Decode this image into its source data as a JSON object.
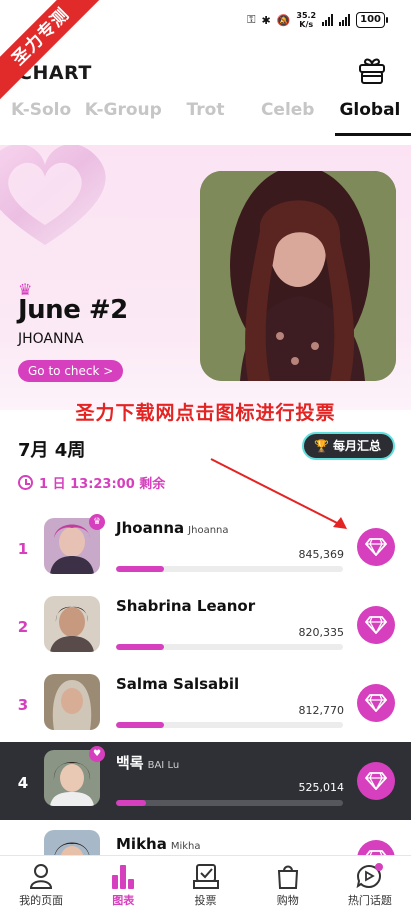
{
  "status_bar": {
    "speed_value": "35.2",
    "speed_unit": "K/s",
    "battery": "100"
  },
  "watermark": "圣力专测",
  "header": {
    "title": "CHART"
  },
  "tabs": [
    {
      "label": "K-Solo"
    },
    {
      "label": "K-Group"
    },
    {
      "label": "Trot"
    },
    {
      "label": "Celeb"
    },
    {
      "label": "Global"
    }
  ],
  "banner": {
    "headline": "June #2",
    "name": "JHOANNA",
    "cta": "Go to check >"
  },
  "overlay_text": "圣力下载网点击图标进行投票",
  "week": {
    "title": "7月 4周",
    "monthly_button": "每月汇总",
    "countdown": "1 日 13:23:00 剩余"
  },
  "ranking": [
    {
      "rank": "1",
      "name": "Jhoanna",
      "sub": "Jhoanna",
      "votes": "845,369",
      "progress": 0.21,
      "highlight": false,
      "crown": true
    },
    {
      "rank": "2",
      "name": "Shabrina Leanor",
      "sub": "",
      "votes": "820,335",
      "progress": 0.21,
      "highlight": false,
      "crown": false
    },
    {
      "rank": "3",
      "name": "Salma Salsabil",
      "sub": "",
      "votes": "812,770",
      "progress": 0.21,
      "highlight": false,
      "crown": false
    },
    {
      "rank": "4",
      "name": "백록",
      "sub": "BAI Lu",
      "votes": "525,014",
      "progress": 0.13,
      "highlight": true,
      "heart": true
    },
    {
      "rank": "",
      "name": "Mikha",
      "sub": "Mikha",
      "votes": "",
      "progress": 0,
      "highlight": false,
      "crown": false
    }
  ],
  "bottom_nav": [
    {
      "label": "我的页面",
      "icon": "user-icon"
    },
    {
      "label": "图表",
      "icon": "chart-icon",
      "active": true
    },
    {
      "label": "投票",
      "icon": "vote-box-icon"
    },
    {
      "label": "购物",
      "icon": "shopping-bag-icon"
    },
    {
      "label": "热门话题",
      "icon": "play-chat-icon"
    }
  ],
  "colors": {
    "accent": "#d63fbd",
    "dark_row": "#2e3036",
    "overlay_red": "#e42323"
  }
}
